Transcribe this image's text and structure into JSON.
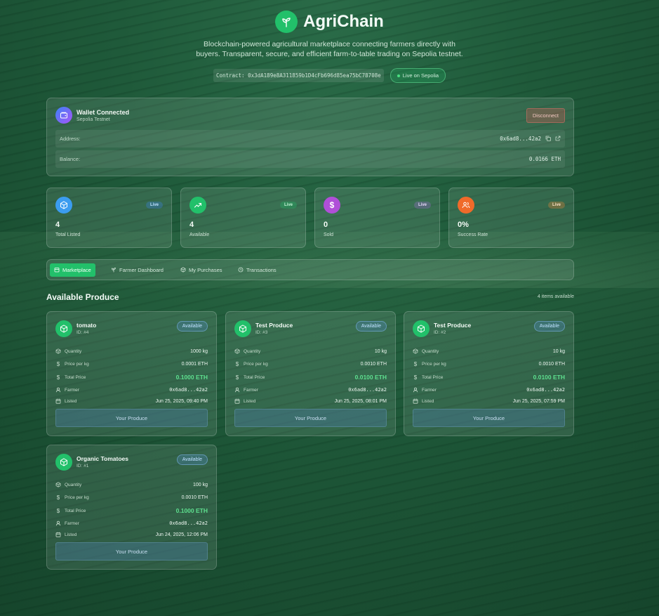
{
  "header": {
    "title": "AgriChain",
    "tagline_line1": "Blockchain-powered agricultural marketplace connecting farmers directly with",
    "tagline_line2": "buyers. Transparent, secure, and efficient farm-to-table trading on Sepolia testnet.",
    "contract": "Contract: 0x3dA189e8A311859b1D4cFb696d85ea75bC78708e",
    "network_pill": "Live on Sepolia"
  },
  "wallet": {
    "title": "Wallet Connected",
    "network": "Sepolia Testnet",
    "disconnect_label": "Disconnect",
    "address_label": "Address:",
    "address_value": "0x6ad8...42a2",
    "balance_label": "Balance:",
    "balance_value": "0.0166 ETH"
  },
  "stats": [
    {
      "value": "4",
      "label": "Total Listed",
      "badge": "Live",
      "icon": "box-icon",
      "color": "#3b9cf0",
      "badge_bg": "rgba(60,130,220,0.35)",
      "badge_fg": "#bfe0ff"
    },
    {
      "value": "4",
      "label": "Available",
      "badge": "Live",
      "icon": "trending-up-icon",
      "color": "#22c06a",
      "badge_bg": "rgba(34,192,106,0.30)",
      "badge_fg": "#bff0d2"
    },
    {
      "value": "0",
      "label": "Sold",
      "badge": "Live",
      "icon": "dollar-icon",
      "color": "#b04fd8",
      "badge_bg": "rgba(150,110,200,0.35)",
      "badge_fg": "#e4d3f7"
    },
    {
      "value": "0%",
      "label": "Success Rate",
      "badge": "Live",
      "icon": "users-icon",
      "color": "#f06a2a",
      "badge_bg": "rgba(200,130,60,0.40)",
      "badge_fg": "#f7dcc0"
    }
  ],
  "tabs": [
    {
      "label": "Marketplace",
      "icon": "store-icon",
      "active": true
    },
    {
      "label": "Farmer Dashboard",
      "icon": "sprout-icon",
      "active": false
    },
    {
      "label": "My Purchases",
      "icon": "box-icon",
      "active": false
    },
    {
      "label": "Transactions",
      "icon": "history-icon",
      "active": false
    }
  ],
  "section": {
    "title": "Available Produce",
    "count": "4 items available"
  },
  "labels": {
    "quantity": "Quantity",
    "price_per_kg": "Price per kg",
    "total_price": "Total Price",
    "farmer": "Farmer",
    "listed": "Listed",
    "available": "Available",
    "your_produce": "Your Produce"
  },
  "produce": [
    {
      "name": "tomato",
      "id": "ID: #4",
      "quantity": "1000 kg",
      "price_per_kg": "0.0001 ETH",
      "total_price": "0.1000 ETH",
      "farmer": "0x6ad8...42a2",
      "listed": "Jun 25, 2025, 09:40 PM"
    },
    {
      "name": "Test Produce",
      "id": "ID: #3",
      "quantity": "10 kg",
      "price_per_kg": "0.0010 ETH",
      "total_price": "0.0100 ETH",
      "farmer": "0x6ad8...42a2",
      "listed": "Jun 25, 2025, 08:01 PM"
    },
    {
      "name": "Test Produce",
      "id": "ID: #2",
      "quantity": "10 kg",
      "price_per_kg": "0.0010 ETH",
      "total_price": "0.0100 ETH",
      "farmer": "0x6ad8...42a2",
      "listed": "Jun 25, 2025, 07:59 PM"
    },
    {
      "name": "Organic Tomatoes",
      "id": "ID: #1",
      "quantity": "100 kg",
      "price_per_kg": "0.0010 ETH",
      "total_price": "0.1000 ETH",
      "farmer": "0x6ad8...42a2",
      "listed": "Jun 24, 2025, 12:06 PM"
    }
  ]
}
